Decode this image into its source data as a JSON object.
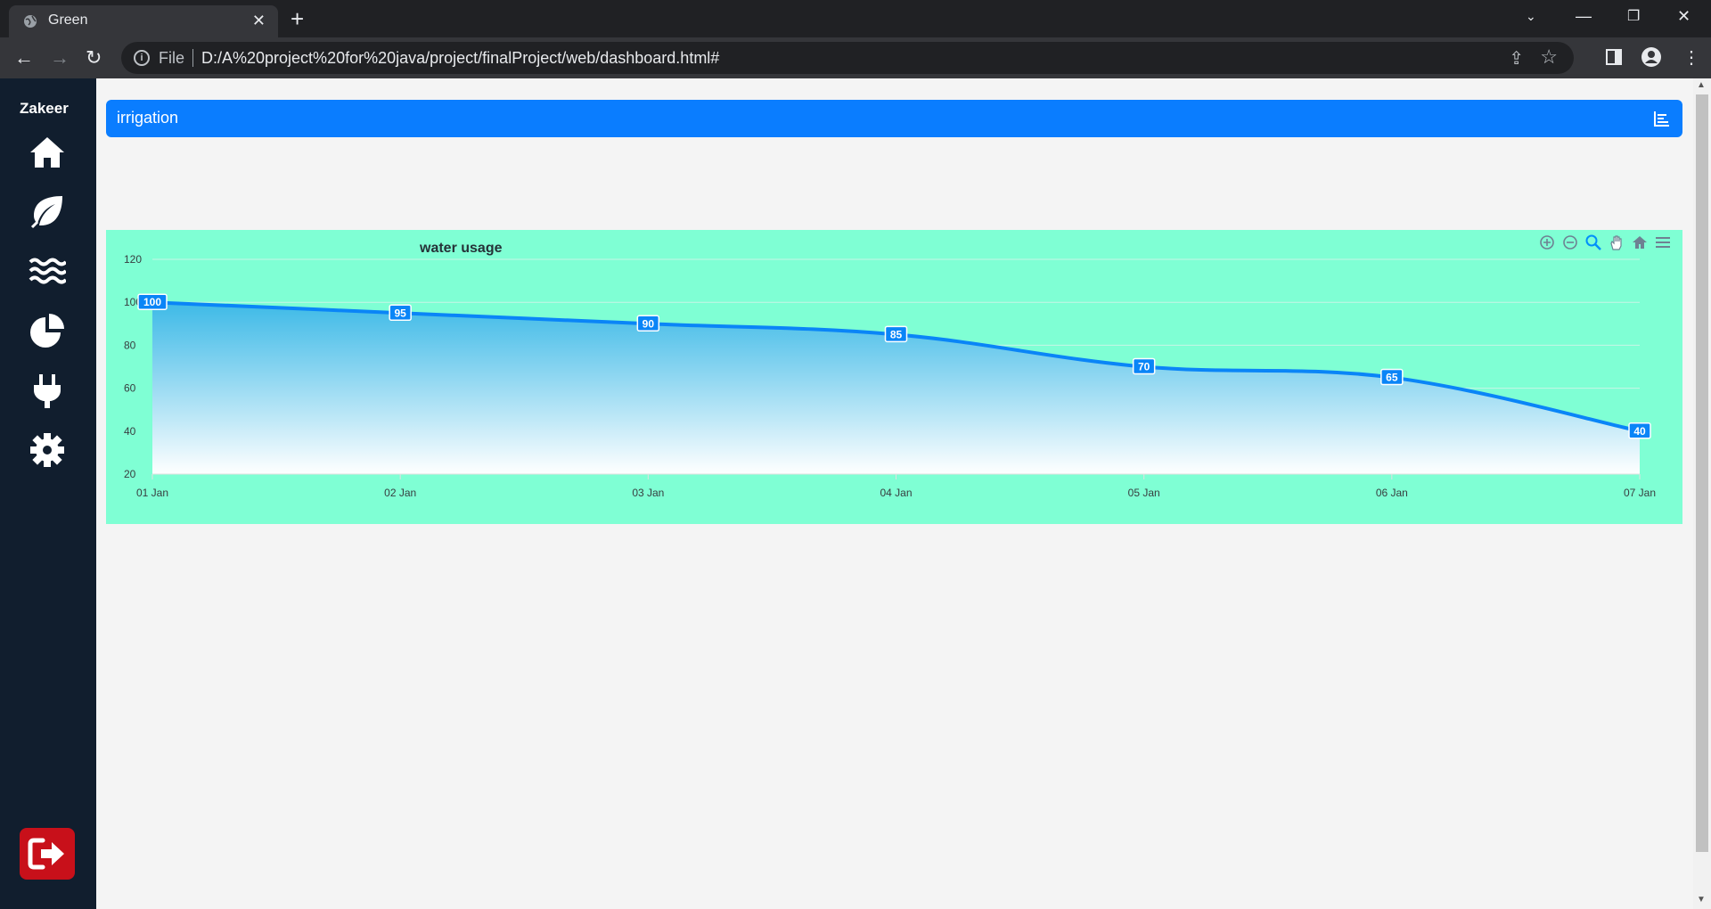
{
  "browser": {
    "tab_title": "Green",
    "url_scheme_label": "File",
    "url": "D:/A%20project%20for%20java/project/finalProject/web/dashboard.html#"
  },
  "sidebar": {
    "brand": "Zakeer",
    "items": [
      {
        "icon": "home-icon"
      },
      {
        "icon": "leaf-icon"
      },
      {
        "icon": "water-icon"
      },
      {
        "icon": "pie-chart-icon"
      },
      {
        "icon": "plug-icon"
      },
      {
        "icon": "gear-icon"
      }
    ],
    "logout_icon": "logout-icon",
    "logout_color": "#c8101a"
  },
  "header": {
    "title": "irrigation",
    "icon": "chart-icon",
    "color": "#0a7dff"
  },
  "chart_data": {
    "type": "area",
    "title": "water usage",
    "categories": [
      "01 Jan",
      "02 Jan",
      "03 Jan",
      "04 Jan",
      "05 Jan",
      "06 Jan",
      "07 Jan"
    ],
    "series": [
      {
        "values": [
          100,
          95,
          90,
          85,
          70,
          65,
          40
        ]
      }
    ],
    "yticks": [
      "20",
      "40",
      "60",
      "80",
      "100",
      "120"
    ],
    "ylim": [
      20,
      120
    ],
    "grid": true,
    "line_color": "#0a85f7",
    "background": "#7fffd4"
  }
}
